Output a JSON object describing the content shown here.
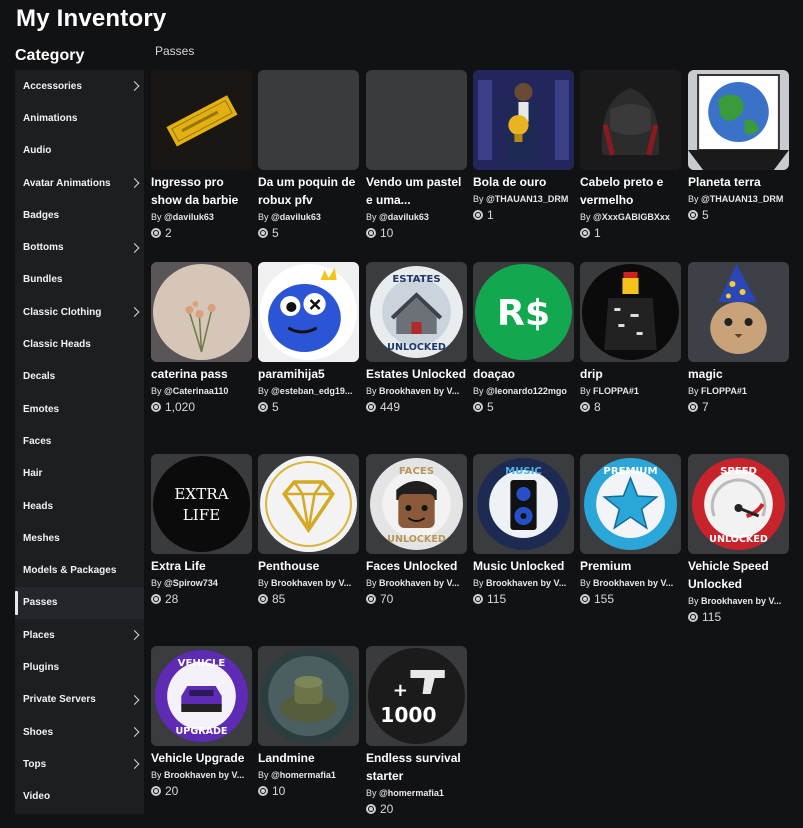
{
  "page_title": "My Inventory",
  "sidebar": {
    "heading": "Category",
    "items": [
      {
        "label": "Accessories",
        "chevron": true
      },
      {
        "label": "Animations",
        "chevron": false
      },
      {
        "label": "Audio",
        "chevron": false
      },
      {
        "label": "Avatar Animations",
        "chevron": true
      },
      {
        "label": "Badges",
        "chevron": false
      },
      {
        "label": "Bottoms",
        "chevron": true
      },
      {
        "label": "Bundles",
        "chevron": false
      },
      {
        "label": "Classic Clothing",
        "chevron": true
      },
      {
        "label": "Classic Heads",
        "chevron": false
      },
      {
        "label": "Decals",
        "chevron": false
      },
      {
        "label": "Emotes",
        "chevron": false
      },
      {
        "label": "Faces",
        "chevron": false
      },
      {
        "label": "Hair",
        "chevron": false
      },
      {
        "label": "Heads",
        "chevron": false
      },
      {
        "label": "Meshes",
        "chevron": false
      },
      {
        "label": "Models & Packages",
        "chevron": false
      },
      {
        "label": "Passes",
        "chevron": false,
        "active": true
      },
      {
        "label": "Places",
        "chevron": true
      },
      {
        "label": "Plugins",
        "chevron": false
      },
      {
        "label": "Private Servers",
        "chevron": true
      },
      {
        "label": "Shoes",
        "chevron": true
      },
      {
        "label": "Tops",
        "chevron": true
      },
      {
        "label": "Video",
        "chevron": false
      }
    ]
  },
  "section_label": "Passes",
  "items": [
    {
      "name": "Ingresso pro show da barbie",
      "by": "By",
      "creator": "@daviluk63",
      "price": "2",
      "icon": "golden-ticket-icon"
    },
    {
      "name": "Da um poquin de robux pfv",
      "by": "By",
      "creator": "@daviluk63",
      "price": "5",
      "icon": "blank-thumbnail"
    },
    {
      "name": "Vendo um pastel e uma...",
      "by": "By",
      "creator": "@daviluk63",
      "price": "10",
      "icon": "blank-thumbnail"
    },
    {
      "name": "Bola de ouro",
      "by": "By",
      "creator": "@THAUAN13_DRM",
      "price": "1",
      "icon": "trophy-man-icon"
    },
    {
      "name": "Cabelo preto e vermelho",
      "by": "By",
      "creator": "@XxxGABIGBXxx",
      "price": "1",
      "icon": "hair-icon"
    },
    {
      "name": "Planeta terra",
      "by": "By",
      "creator": "@THAUAN13_DRM",
      "price": "5",
      "icon": "earth-icon"
    },
    {
      "name": "caterina pass",
      "by": "By",
      "creator": "@Caterinaa110",
      "price": "1,020",
      "icon": "flowers-icon"
    },
    {
      "name": "paramihija5",
      "by": "By",
      "creator": "@esteban_edg19...",
      "price": "5",
      "icon": "blue-monster-icon"
    },
    {
      "name": "Estates Unlocked",
      "by": "By",
      "creator": "Brookhaven by V...",
      "price": "449",
      "icon": "estates-house-icon"
    },
    {
      "name": "doaçao",
      "by": "By",
      "creator": "@leonardo122mgo",
      "price": "5",
      "icon": "robux-symbol-icon"
    },
    {
      "name": "drip",
      "by": "By",
      "creator": "FLOPPA#1",
      "price": "8",
      "icon": "drip-avatar-icon"
    },
    {
      "name": "magic",
      "by": "By",
      "creator": "FLOPPA#1",
      "price": "7",
      "icon": "wizard-cat-icon"
    },
    {
      "name": "Extra Life",
      "by": "By",
      "creator": "@Spirow734",
      "price": "28",
      "icon": "extra-life-icon",
      "badge_lines": [
        "EXTRA",
        "LIFE"
      ]
    },
    {
      "name": "Penthouse",
      "by": "By",
      "creator": "Brookhaven by V...",
      "price": "85",
      "icon": "diamond-icon"
    },
    {
      "name": "Faces Unlocked",
      "by": "By",
      "creator": "Brookhaven by V...",
      "price": "70",
      "icon": "faces-face-icon"
    },
    {
      "name": "Music Unlocked",
      "by": "By",
      "creator": "Brookhaven by V...",
      "price": "115",
      "icon": "speaker-icon"
    },
    {
      "name": "Premium",
      "by": "By",
      "creator": "Brookhaven by V...",
      "price": "155",
      "icon": "star-icon"
    },
    {
      "name": "Vehicle Speed Unlocked",
      "by": "By",
      "creator": "Brookhaven by V...",
      "price": "115",
      "icon": "speedometer-icon"
    },
    {
      "name": "Vehicle Upgrade",
      "by": "By",
      "creator": "Brookhaven by V...",
      "price": "20",
      "icon": "vehicle-upgrade-icon"
    },
    {
      "name": "Landmine",
      "by": "By",
      "creator": "@homermafia1",
      "price": "10",
      "icon": "landmine-icon"
    },
    {
      "name": "Endless survival starter",
      "by": "By",
      "creator": "@homermafia1",
      "price": "20",
      "icon": "gun-1000-icon",
      "badge_lines": [
        "+",
        "1000"
      ]
    }
  ],
  "badge_texts": {
    "estates": [
      "ESTATES",
      "UNLOCKED"
    ],
    "faces": [
      "FACES",
      "UNLOCKED"
    ],
    "music": [
      "MUSIC"
    ],
    "premium": [
      "PREMIUM"
    ],
    "speed": [
      "SPEED",
      "UNLOCKED"
    ],
    "vehicle": [
      "VEHICLE",
      "UPGRADE"
    ],
    "robux": [
      "R$"
    ]
  }
}
